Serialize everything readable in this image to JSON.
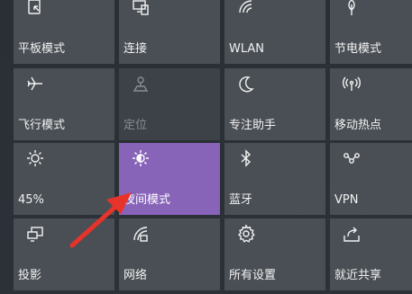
{
  "tiles": [
    {
      "label": "平板模式",
      "icon": "tablet-mode-icon"
    },
    {
      "label": "连接",
      "icon": "connect-icon"
    },
    {
      "label": "WLAN",
      "icon": "wifi-icon"
    },
    {
      "label": "节电模式",
      "icon": "battery-saver-icon"
    },
    {
      "label": "飞行模式",
      "icon": "airplane-icon"
    },
    {
      "label": "定位",
      "icon": "location-icon"
    },
    {
      "label": "专注助手",
      "icon": "moon-icon"
    },
    {
      "label": "移动热点",
      "icon": "hotspot-icon"
    },
    {
      "label": "45%",
      "icon": "brightness-icon"
    },
    {
      "label": "夜间模式",
      "icon": "night-light-icon"
    },
    {
      "label": "蓝牙",
      "icon": "bluetooth-icon"
    },
    {
      "label": "VPN",
      "icon": "vpn-icon"
    },
    {
      "label": "投影",
      "icon": "project-icon"
    },
    {
      "label": "网络",
      "icon": "network-icon"
    },
    {
      "label": "所有设置",
      "icon": "settings-gear-icon"
    },
    {
      "label": "就近共享",
      "icon": "nearby-share-icon"
    }
  ],
  "colors": {
    "accent": "#8764b8",
    "tile": "#4a4f55",
    "tile_disabled": "#3d4248",
    "annotation_arrow": "#e8332a"
  }
}
